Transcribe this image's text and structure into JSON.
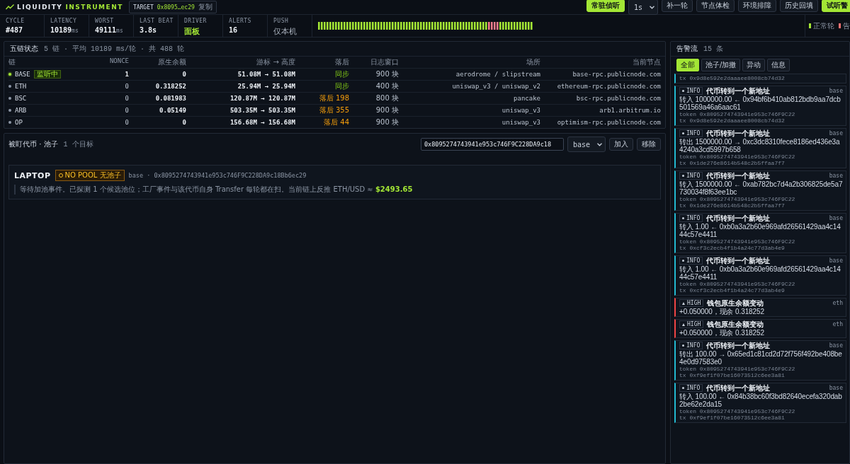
{
  "brand": {
    "word1": "LIQUIDITY",
    "word2": "INSTRUMENT"
  },
  "target_chip": {
    "label": "TARGET",
    "address": "0x8095…ec29",
    "action": "复制"
  },
  "toolbar": [
    {
      "label": "常驻侦听",
      "kind": "primary"
    },
    {
      "label": "1s",
      "kind": "select"
    },
    {
      "label": "补一轮",
      "kind": "plain"
    },
    {
      "label": "节点体检",
      "kind": "plain"
    },
    {
      "label": "环境排障",
      "kind": "plain"
    },
    {
      "label": "历史回填",
      "kind": "plain"
    },
    {
      "label": "试听警",
      "kind": "primary"
    }
  ],
  "stats": [
    {
      "label": "CYCLE",
      "value": "#487",
      "kind": "plain"
    },
    {
      "label": "LATENCY",
      "value": "10189",
      "unit": "ms",
      "kind": "plain"
    },
    {
      "label": "WORST",
      "value": "49111",
      "unit": "ms",
      "kind": "plain"
    },
    {
      "label": "LAST BEAT",
      "value": "3.8s",
      "kind": "plain"
    },
    {
      "label": "DRIVER",
      "value": "面板",
      "kind": "accent"
    },
    {
      "label": "ALERTS",
      "value": "16",
      "kind": "plain"
    },
    {
      "label": "PUSH",
      "value": "仅本机",
      "kind": "muted"
    }
  ],
  "legend": [
    {
      "label": "正常轮",
      "color": "#a3e635"
    },
    {
      "label": "告",
      "color": "#f87171"
    }
  ],
  "chains_panel": {
    "title": "五链状态",
    "meta": "5 链 · 平均 10189 ms/轮 · 共 488 轮",
    "columns": [
      "链",
      "NONCE",
      "原生余额",
      "游标 → 高度",
      "落后",
      "日志窗口",
      "场所",
      "当前节点"
    ],
    "rows": [
      {
        "chain": "BASE",
        "active": true,
        "badge": "监听中",
        "nonce": "1",
        "balance": "0",
        "cursor": "51.08M → 51.08M",
        "lag": "同步",
        "behind": false,
        "window": "900 块",
        "venue": "aerodrome / slipstream",
        "node": "base-rpc.publicnode.com"
      },
      {
        "chain": "ETH",
        "active": false,
        "nonce": "0",
        "balance": "0.318252",
        "cursor": "25.94M → 25.94M",
        "lag": "同步",
        "behind": false,
        "window": "400 块",
        "venue": "uniswap_v3 / uniswap_v2",
        "node": "ethereum-rpc.publicnode.com"
      },
      {
        "chain": "BSC",
        "active": false,
        "nonce": "0",
        "balance": "0.081983",
        "cursor": "120.87M → 120.87M",
        "lag": "落后 198",
        "behind": true,
        "window": "800 块",
        "venue": "pancake",
        "node": "bsc-rpc.publicnode.com"
      },
      {
        "chain": "ARB",
        "active": false,
        "nonce": "0",
        "balance": "0.05149",
        "cursor": "503.35M → 503.35M",
        "lag": "落后 355",
        "behind": true,
        "window": "900 块",
        "venue": "uniswap_v3",
        "node": "arb1.arbitrum.io"
      },
      {
        "chain": "OP",
        "active": false,
        "nonce": "0",
        "balance": "0",
        "cursor": "156.68M → 156.68M",
        "lag": "落后 44",
        "behind": true,
        "window": "900 块",
        "venue": "uniswap_v3",
        "node": "optimism-rpc.publicnode.com"
      }
    ]
  },
  "targets_panel": {
    "title": "被盯代币 · 池子",
    "meta": "1 个目标",
    "address_value": "0x8095274743941e953c746F9C228DA9c18",
    "chain_select": "base",
    "add": "加入",
    "remove": "移除",
    "targets": [
      {
        "symbol": "LAPTOP",
        "badge": "NO POOL 无池子",
        "meta": "base · 0x8095274743941e953c746F9C228DA9c18Bb6ec29",
        "note": "等待加池事件。已探测 1 个候选池位；工厂事件与该代币自身 Transfer 每轮都在扫。当前链上反推 ETH/USD ≈ **$2493.65**"
      }
    ]
  },
  "alerts_panel": {
    "title": "告警流",
    "meta": "15 条",
    "filters": [
      {
        "label": "全部",
        "selected": true
      },
      {
        "label": "池子/加撤",
        "selected": false
      },
      {
        "label": "异动",
        "selected": false
      },
      {
        "label": "信息",
        "selected": false
      }
    ],
    "alerts": [
      {
        "tx": "tx 0x9d8e592e2daaaee8008cb74d32"
      },
      {
        "level": "INFO",
        "title": "代币转到一个新地址",
        "chain": "base",
        "body": "转入 1000000.00 ← 0x94bf6b410ab812bdb9aa7dcb501569a46a6aac61",
        "token": "token 0x8095274743941e953c746F9C22",
        "tx": "tx 0x9d8e592e2daaaee8008cb74d32"
      },
      {
        "level": "INFO",
        "title": "代币转到一个新地址",
        "chain": "base",
        "body": "转出 1500000.00 → 0xc3dc8310fece8186ed436e3a4240a3cd5997b658",
        "token": "token 0x8095274743941e953c746F9C22",
        "tx": "tx 0x1de276e8614b548c2b5ffaa7f7"
      },
      {
        "level": "INFO",
        "title": "代币转到一个新地址",
        "chain": "base",
        "body": "转入 1500000.00 ← 0xab782bc7d4a2b306825de5a7730034f8f63ee1bc",
        "token": "token 0x8095274743941e953c746F9C22",
        "tx": "tx 0x1de276e8614b548c2b5ffaa7f7"
      },
      {
        "level": "INFO",
        "title": "代币转到一个新地址",
        "chain": "base",
        "body": "转入 1.00 ← 0xb0a3a2b60e969afd26561429aa4c1444c57e4411",
        "token": "token 0x8095274743941e953c746F9C22",
        "tx": "tx 0xcf3c2ecb4f1b4a24c77d3ab4e9"
      },
      {
        "level": "INFO",
        "title": "代币转到一个新地址",
        "chain": "base",
        "body": "转入 1.00 ← 0xb0a3a2b60e969afd26561429aa4c1444c57e4411",
        "token": "token 0x8095274743941e953c746F9C22",
        "tx": "tx 0xcf3c2ecb4f1b4a24c77d3ab4e9"
      },
      {
        "level": "HIGH",
        "title": "钱包原生余额变动",
        "chain": "eth",
        "body": "+0.050000，现余 0.318252"
      },
      {
        "level": "HIGH",
        "title": "钱包原生余额变动",
        "chain": "eth",
        "body": "+0.050000，现余 0.318252"
      },
      {
        "level": "INFO",
        "title": "代币转到一个新地址",
        "chain": "base",
        "body": "转出 100.00 → 0x65ed1c81cd2d72f756f492be408be4e0d97583e0",
        "token": "token 0x8095274743941e953c746F9C22",
        "tx": "tx 0xf9ef1f07be16073512c6ee3a81"
      },
      {
        "level": "INFO",
        "title": "代币转到一个新地址",
        "chain": "base",
        "body": "转入 100.00 ← 0x84b38bc60f3bd82640ecefa320dab2be62e2da15",
        "token": "token 0x8095274743941e953c746F9C22",
        "tx": "tx 0xf9ef1f07be16073512c6ee3a81"
      }
    ]
  }
}
